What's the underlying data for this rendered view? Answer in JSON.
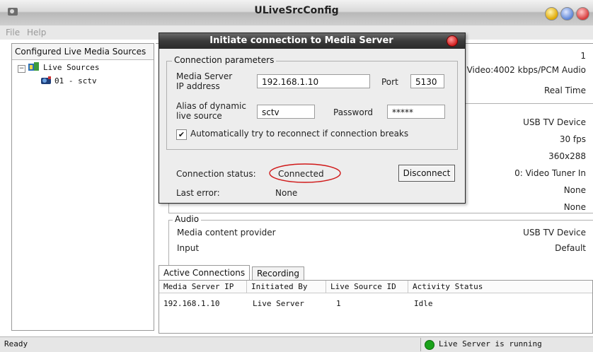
{
  "window": {
    "title": "ULiveSrcConfig"
  },
  "menu": {
    "file": "File",
    "help": "Help"
  },
  "tree": {
    "header": "Configured Live Media Sources",
    "root": "Live Sources",
    "child": "01 - sctv"
  },
  "right": {
    "top_values": [
      "1",
      "Video:4002 kbps/PCM Audio",
      "Real Time"
    ],
    "video_values": [
      "USB TV Device",
      "30 fps",
      "360x288",
      "0: Video Tuner In",
      "None",
      "None"
    ],
    "audio": {
      "title": "Audio",
      "provider_label": "Media content provider",
      "provider_value": "USB TV Device",
      "input_label": "Input",
      "input_value": "Default"
    }
  },
  "tabs": {
    "active": "Active Connections",
    "recording": "Recording"
  },
  "table": {
    "columns": [
      "Media Server IP",
      "Initiated By",
      "Live Source ID",
      "Activity Status"
    ],
    "rows": [
      [
        "192.168.1.10",
        "Live Server",
        "1",
        "Idle"
      ]
    ]
  },
  "status": {
    "left": "Ready",
    "right": "Live Server is running",
    "indicator_color": "#1aa21a"
  },
  "dialog": {
    "title": "Initiate connection to Media Server",
    "group_title": "Connection parameters",
    "ip_label_1": "Media Server",
    "ip_label_2": "IP address",
    "ip_value": "192.168.1.10",
    "port_label": "Port",
    "port_value": "5130",
    "alias_label_1": "Alias of dynamic",
    "alias_label_2": "live source",
    "alias_value": "sctv",
    "password_label": "Password",
    "password_value": "*****",
    "reconnect_label": "Automatically try to reconnect if connection breaks",
    "reconnect_checked": true,
    "status_label": "Connection status:",
    "status_value": "Connected",
    "error_label": "Last error:",
    "error_value": "None",
    "disconnect_label": "Disconnect",
    "highlight_color": "#d01818"
  }
}
